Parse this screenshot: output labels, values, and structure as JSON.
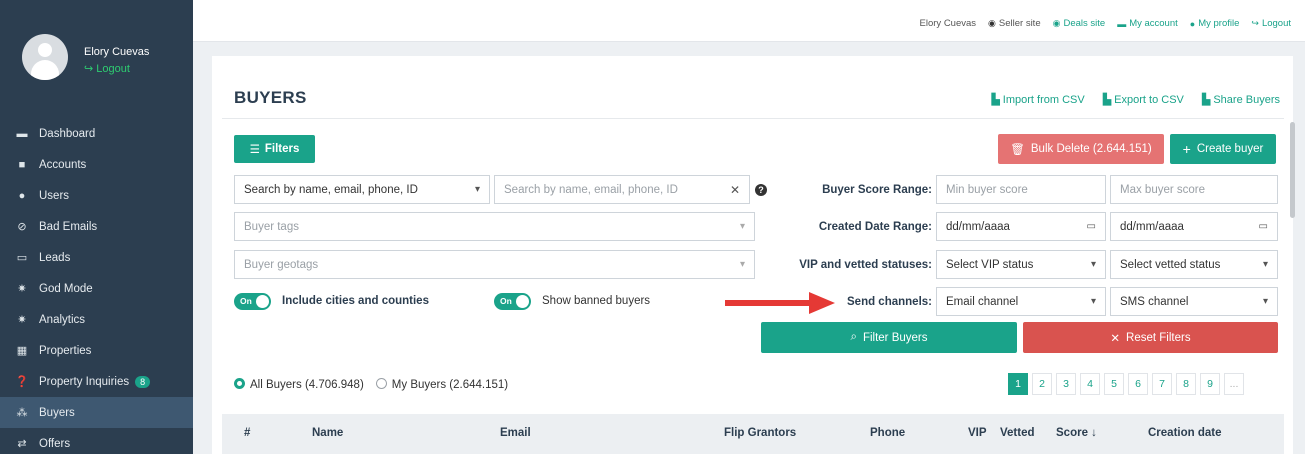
{
  "sidebar": {
    "profile_name": "Elory Cuevas",
    "logout_label": "Logout",
    "items": [
      {
        "label": "Dashboard",
        "icon": "dashboard-icon"
      },
      {
        "label": "Accounts",
        "icon": "briefcase-icon"
      },
      {
        "label": "Users",
        "icon": "user-icon"
      },
      {
        "label": "Bad Emails",
        "icon": "ban-icon"
      },
      {
        "label": "Leads",
        "icon": "id-card-icon"
      },
      {
        "label": "God Mode",
        "icon": "gear-icon"
      },
      {
        "label": "Analytics",
        "icon": "gear-icon"
      },
      {
        "label": "Properties",
        "icon": "building-icon"
      },
      {
        "label": "Property Inquiries",
        "icon": "question-circle-icon",
        "badge": "8"
      },
      {
        "label": "Buyers",
        "icon": "users-icon",
        "active": true
      },
      {
        "label": "Offers",
        "icon": "handshake-icon"
      }
    ]
  },
  "topbar": {
    "user": "Elory Cuevas",
    "seller_site": "Seller site",
    "deals_site": "Deals site",
    "my_account": "My account",
    "my_profile": "My profile",
    "logout": "Logout"
  },
  "page": {
    "title": "BUYERS",
    "import_csv": "Import from CSV",
    "export_csv": "Export to CSV",
    "share_buyers": "Share Buyers"
  },
  "filters": {
    "filters_button": "Filters",
    "bulk_delete": "Bulk Delete (2.644.151)",
    "create_buyer": "Create buyer",
    "search_by_select": "Search by name, email, phone, ID",
    "search_placeholder": "Search by name, email, phone, ID",
    "buyer_tags_placeholder": "Buyer tags",
    "buyer_geotags_placeholder": "Buyer geotags",
    "include_cities_label": "Include cities and counties",
    "show_banned_label": "Show banned buyers",
    "toggle_on_text": "On",
    "score_range_label": "Buyer Score Range:",
    "min_score_placeholder": "Min buyer score",
    "max_score_placeholder": "Max buyer score",
    "created_date_label": "Created Date Range:",
    "date_from": "dd/mm/aaaa",
    "date_to": "dd/mm/aaaa",
    "vip_vetted_label": "VIP and vetted statuses:",
    "vip_select": "Select VIP status",
    "vetted_select": "Select vetted status",
    "send_channels_label": "Send channels:",
    "email_channel": "Email channel",
    "sms_channel": "SMS channel",
    "filter_buyers": "Filter Buyers",
    "reset_filters": "Reset Filters",
    "help_mark": "?"
  },
  "listing": {
    "all_buyers": "All Buyers (4.706.948)",
    "my_buyers": "My Buyers (2.644.151)",
    "pages": [
      "1",
      "2",
      "3",
      "4",
      "5",
      "6",
      "7",
      "8",
      "9",
      "..."
    ],
    "current_page": "1"
  },
  "table": {
    "headers": [
      "#",
      "Name",
      "Email",
      "Flip Grantors",
      "Phone",
      "VIP",
      "Vetted",
      "Score ↓",
      "Creation date"
    ]
  },
  "colors": {
    "accent": "#1aa38a",
    "sidebar_bg": "#2c3e50",
    "danger": "#d9534f",
    "bulk_delete": "#e57373",
    "arrow": "#e53935"
  }
}
